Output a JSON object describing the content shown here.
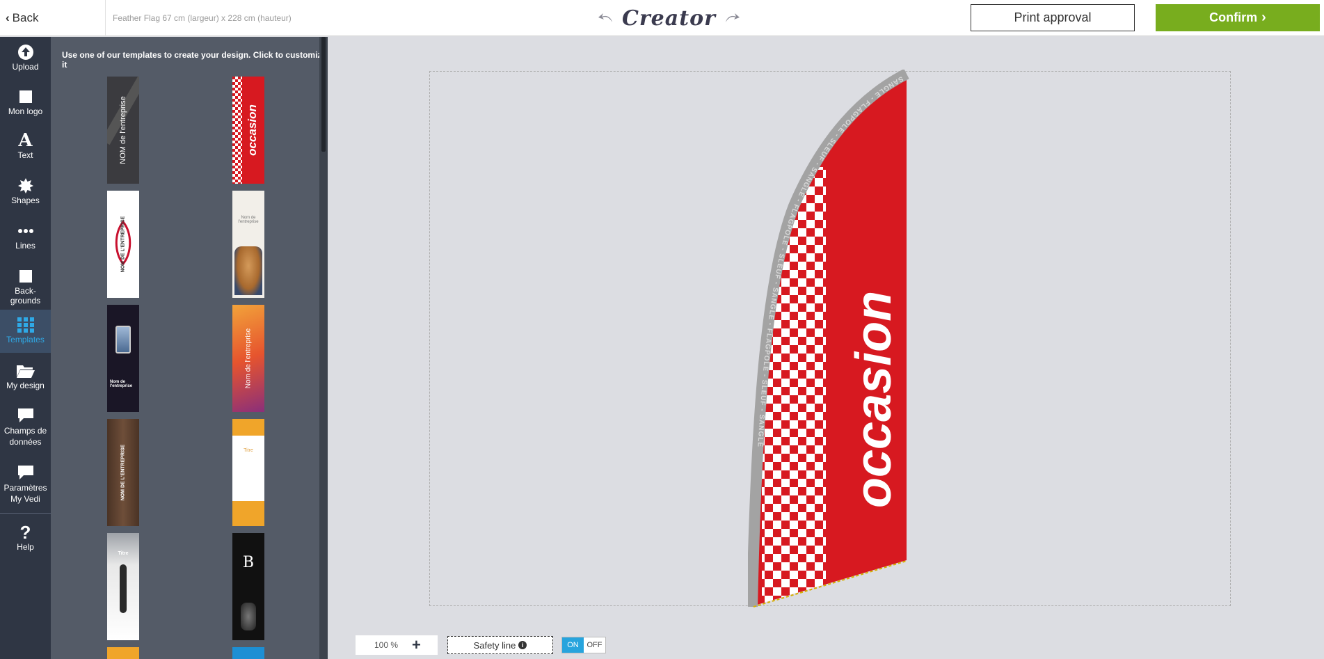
{
  "header": {
    "back_label": "Back",
    "product_label": "Feather Flag 67 cm (largeur) x 228 cm (hauteur)",
    "logo_text": "Creator",
    "print_label": "Print approval",
    "confirm_label": "Confirm",
    "confirm_color": "#78ad1e"
  },
  "sidebar": {
    "items": [
      {
        "label": "Upload",
        "icon": "upload-icon"
      },
      {
        "label": "Mon logo",
        "icon": "square-icon"
      },
      {
        "label": "Text",
        "icon": "text-icon"
      },
      {
        "label": "Shapes",
        "icon": "star-icon"
      },
      {
        "label": "Lines",
        "icon": "dots-icon"
      },
      {
        "label": "Back- grounds",
        "icon": "square-icon"
      },
      {
        "label": "Templates",
        "icon": "grid-icon",
        "active": true
      },
      {
        "label": "My design",
        "icon": "folder-icon"
      },
      {
        "label": "Champs de données",
        "icon": "comment-icon"
      },
      {
        "label": "Paramètres My Vedi",
        "icon": "comment-icon"
      },
      {
        "label": "Help",
        "icon": "question-icon"
      }
    ],
    "active_color": "#2fa9e6"
  },
  "templates_panel": {
    "title": "Use one of our templates to create your design. Click to customize it",
    "templates": [
      {
        "text": "NOM de l'entreprise"
      },
      {
        "text": "occasion"
      },
      {
        "text": "NOM DE L'ENTREPRISE"
      },
      {
        "text": "Nom de l'entreprise"
      },
      {
        "text": "Nom de l'entreprise"
      },
      {
        "text": "Nom de l'entreprise"
      },
      {
        "text": "NOM DE L'ENTREPRISE"
      },
      {
        "text": "Titre"
      },
      {
        "text": "Titre"
      },
      {
        "text": "B"
      }
    ]
  },
  "canvas": {
    "flag_text": "occasion",
    "border_text": "SANGLE - FLAGPOLE - SLEUF - SANGLE - FLAGPOLE - SLEUF - SANGLE - FLAGPOLE - SLEUF - SANGLE",
    "flag_color": "#d71920"
  },
  "footer": {
    "zoom_label": "100 %",
    "safety_line_label": "Safety line",
    "toggle_on": "ON",
    "toggle_off": "OFF"
  }
}
